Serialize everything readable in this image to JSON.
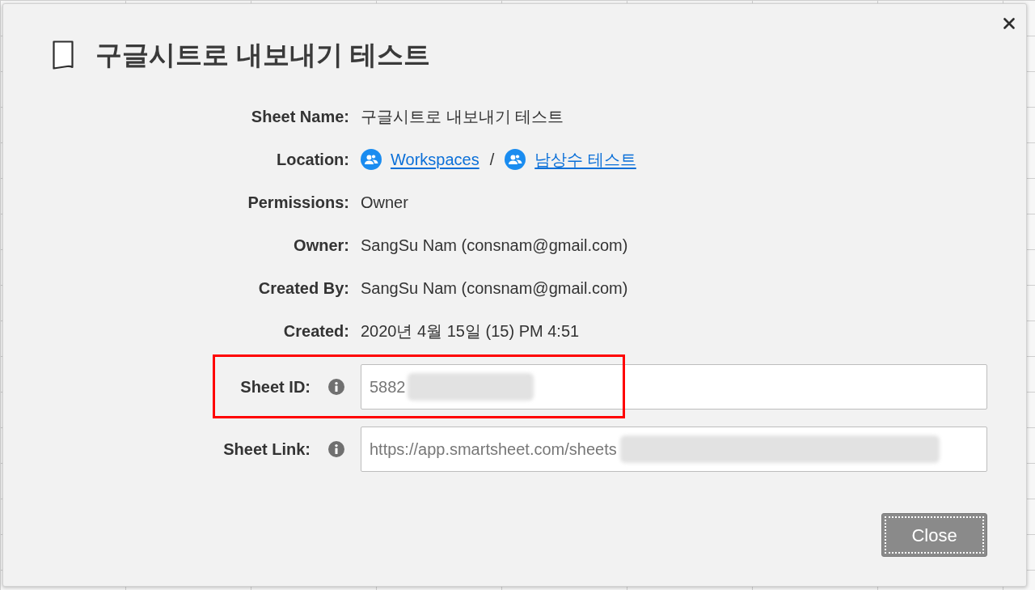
{
  "dialog": {
    "title": "구글시트로 내보내기 테스트",
    "details": [
      {
        "kind": "text",
        "label": "Sheet Name:",
        "value": "구글시트로 내보내기 테스트"
      },
      {
        "kind": "location",
        "label": "Location:",
        "links": [
          "Workspaces",
          "남상수 테스트"
        ],
        "separator": "/"
      },
      {
        "kind": "text",
        "label": "Permissions:",
        "value": "Owner"
      },
      {
        "kind": "text",
        "label": "Owner:",
        "value": "SangSu Nam (consnam@gmail.com)"
      },
      {
        "kind": "text",
        "label": "Created By:",
        "value": "SangSu Nam (consnam@gmail.com)"
      },
      {
        "kind": "text",
        "label": "Created:",
        "value": "2020년 4월 15일 (15) PM 4:51"
      }
    ],
    "fields": [
      {
        "label": "Sheet ID:",
        "value": "5882",
        "redacted": true,
        "highlighted": true
      },
      {
        "label": "Sheet Link:",
        "value": "https://app.smartsheet.com/sheets",
        "redacted": true,
        "highlighted": false
      }
    ],
    "buttons": [
      {
        "label": "Close",
        "focused": true
      }
    ]
  }
}
